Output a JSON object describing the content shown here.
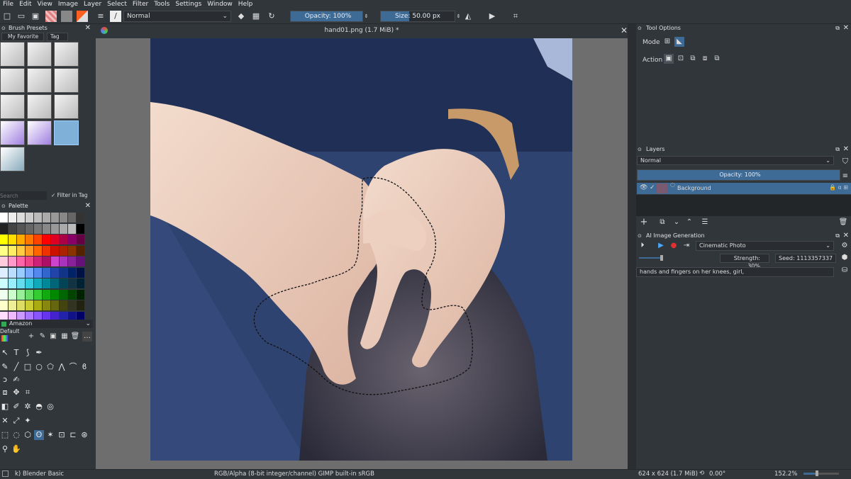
{
  "menu": [
    "File",
    "Edit",
    "View",
    "Image",
    "Layer",
    "Select",
    "Filter",
    "Tools",
    "Settings",
    "Window",
    "Help"
  ],
  "toolbar": {
    "blend_mode": "Normal",
    "opacity": "Opacity: 100%",
    "size": "Size: 50.00 px"
  },
  "document": {
    "title": "hand01.png (1.7 MiB) *"
  },
  "brush_presets": {
    "title": "Brush Presets",
    "filter": "My Favorite",
    "tag": "Tag",
    "search_placeholder": "Search",
    "filter_in_tag": "Filter in Tag"
  },
  "palette": {
    "title": "Palette",
    "name": "Amazon",
    "set": "Default"
  },
  "tool_options": {
    "title": "Tool Options",
    "mode_label": "Mode",
    "action_label": "Action"
  },
  "layers": {
    "title": "Layers",
    "blend_mode": "Normal",
    "opacity": "Opacity:  100%",
    "items": [
      {
        "name": "Background"
      }
    ]
  },
  "ai": {
    "title": "AI Image Generation",
    "style": "Cinematic Photo",
    "strength": "Strength: 30%",
    "seed": "Seed: 1113357337",
    "prompt": "hands and fingers on her knees, girl,"
  },
  "status": {
    "brush": "k) Blender Basic",
    "color_info": "RGB/Alpha (8-bit integer/channel)  GIMP built-in sRGB",
    "dimensions": "624 x 624 (1.7 MiB)",
    "rotation": "0.00°",
    "zoom": "152.2%"
  },
  "colors": {
    "accent": "#3e6b96",
    "panel": "#31363b"
  }
}
